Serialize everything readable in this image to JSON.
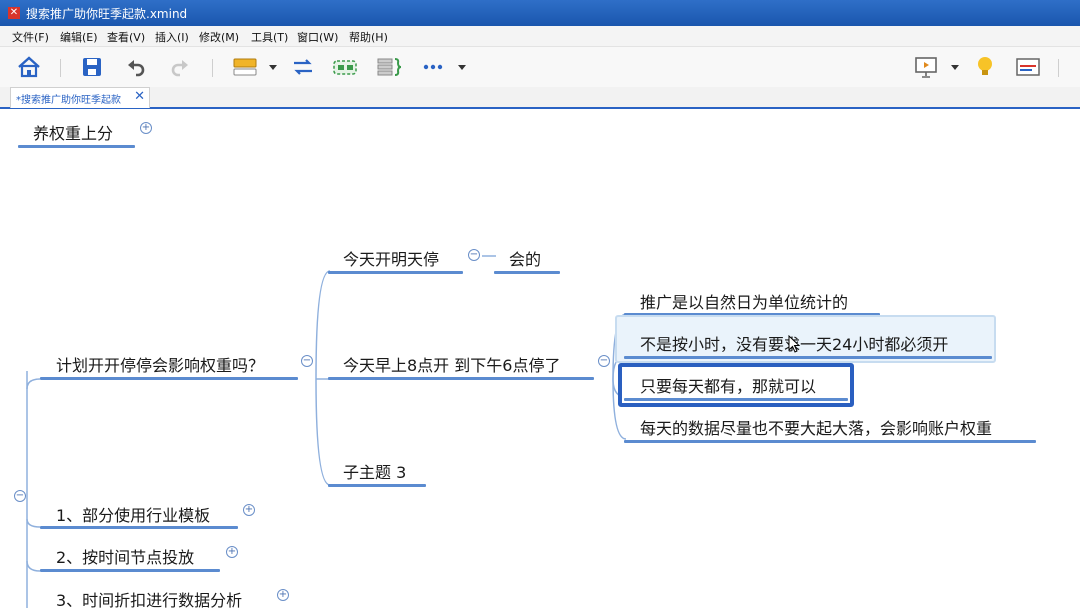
{
  "window": {
    "title": "搜索推广助你旺季起款.xmind",
    "app_icon": "xmind-icon"
  },
  "menu": [
    "文件(F)",
    "编辑(E)",
    "查看(V)",
    "插入(I)",
    "修改(M)",
    "工具(T)",
    "窗口(W)",
    "帮助(H)"
  ],
  "toolbar": {
    "icons": [
      "home-icon",
      "save-icon",
      "undo-icon",
      "redo-icon",
      "topic-style-icon",
      "relationship-icon",
      "boundary-icon",
      "summary-icon",
      "more-icon",
      "presentation-icon",
      "idea-bulb-icon",
      "panel-icon"
    ]
  },
  "tab": {
    "label": "*搜索推广助你旺季起款",
    "close": "✕"
  },
  "mindmap": {
    "top_topic": "养权重上分",
    "question": "计划开开停停会影响权重吗？",
    "branch1": "今天开明天停",
    "branch1_child": "会的",
    "branch2": "今天早上8点开 到下午6点停了",
    "branch2_children": [
      "推广是以自然日为单位统计的",
      "不是按小时，没有要求一天24小时都必须开",
      "只要每天都有，那就可以",
      "每天的数据尽量也不要大起大落，会影响账户权重"
    ],
    "branch3": "子主题 3",
    "siblings": [
      "1、部分使用行业模板",
      "2、按时间节点投放",
      "3、时间折扣进行数据分析"
    ],
    "expand_symbol": "+",
    "collapse_symbol": "−"
  },
  "colors": {
    "titlebar": "#1e5bb4",
    "accent": "#2a63c4",
    "underline": "#5b8bd0",
    "connector": "#8fb0dd"
  }
}
